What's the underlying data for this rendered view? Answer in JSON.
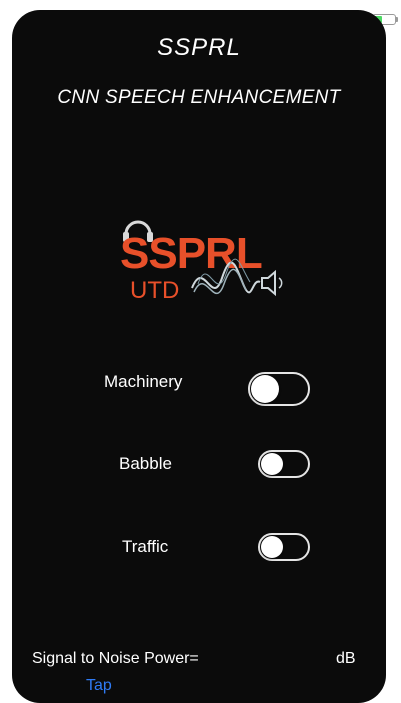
{
  "app": {
    "title": "SSPRL",
    "subtitle": "CNN SPEECH ENHANCEMENT"
  },
  "logo": {
    "name": "SSPRL",
    "sub": "UTD",
    "accent_color": "#e8502a"
  },
  "toggles": [
    {
      "label": "Machinery",
      "on": false
    },
    {
      "label": "Babble",
      "on": false
    },
    {
      "label": "Traffic",
      "on": false
    }
  ],
  "snr": {
    "label": "Signal to Noise Power=",
    "unit": "dB",
    "action_label": "Tap"
  },
  "colors": {
    "background": "#0b0b0b",
    "text": "#ffffff",
    "link": "#2f7bf5",
    "battery": "#4cd964"
  }
}
